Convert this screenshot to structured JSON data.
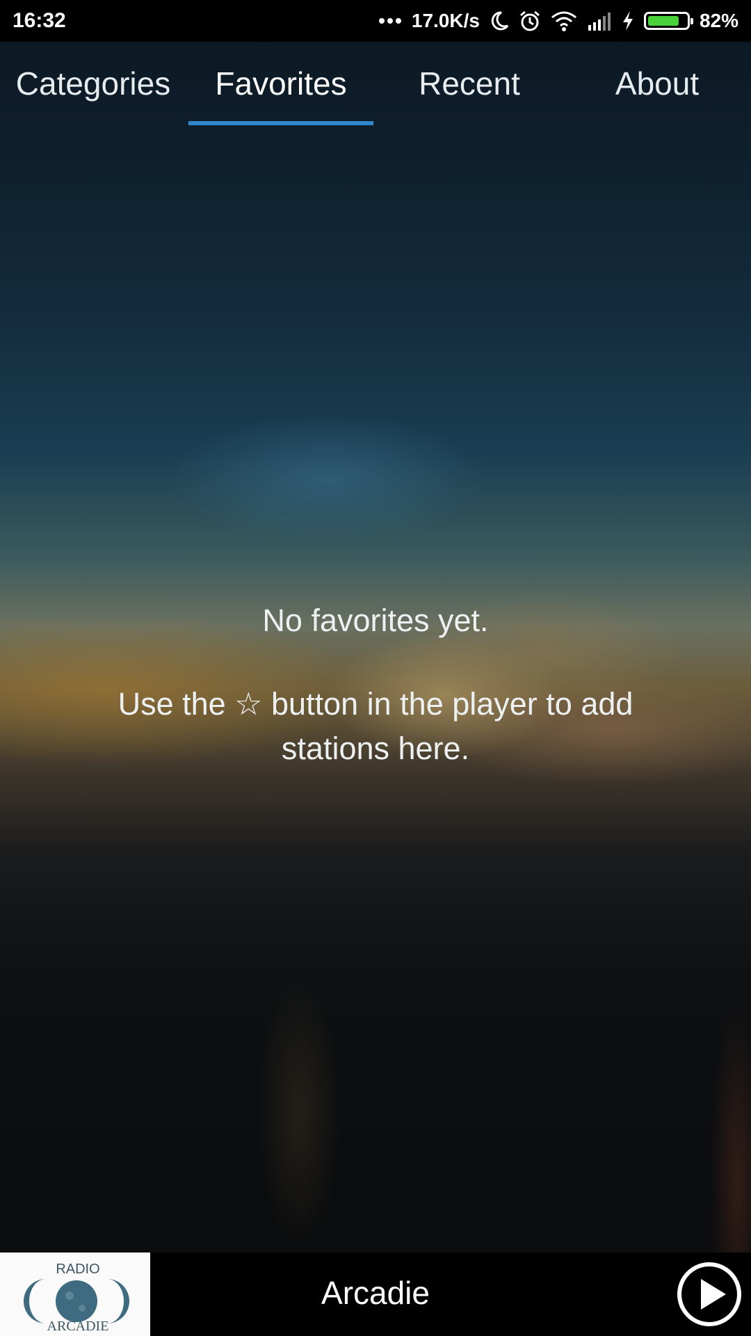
{
  "status_bar": {
    "time": "16:32",
    "network_speed": "17.0K/s",
    "battery_percent": "82%",
    "battery_level": 0.82,
    "icons": [
      "more-dots-icon",
      "moon-icon",
      "alarm-icon",
      "wifi-icon",
      "signal-icon",
      "charging-bolt-icon",
      "battery-icon"
    ]
  },
  "tabs": [
    {
      "label": "Categories",
      "selected": false
    },
    {
      "label": "Favorites",
      "selected": true
    },
    {
      "label": "Recent",
      "selected": false
    },
    {
      "label": "About",
      "selected": false
    }
  ],
  "empty_state": {
    "title": "No favorites yet.",
    "message": "Use the ☆ button in the player to add stations here."
  },
  "player": {
    "station_logo": {
      "top_text": "RADIO",
      "bottom_text": "ARCADIE"
    },
    "station_name": "Arcadie",
    "play_icon": "play-circle-icon"
  },
  "colors": {
    "tab_indicator": "#2f86c8",
    "battery_fill": "#49d13a",
    "logo_moon": "#3f6b80"
  }
}
